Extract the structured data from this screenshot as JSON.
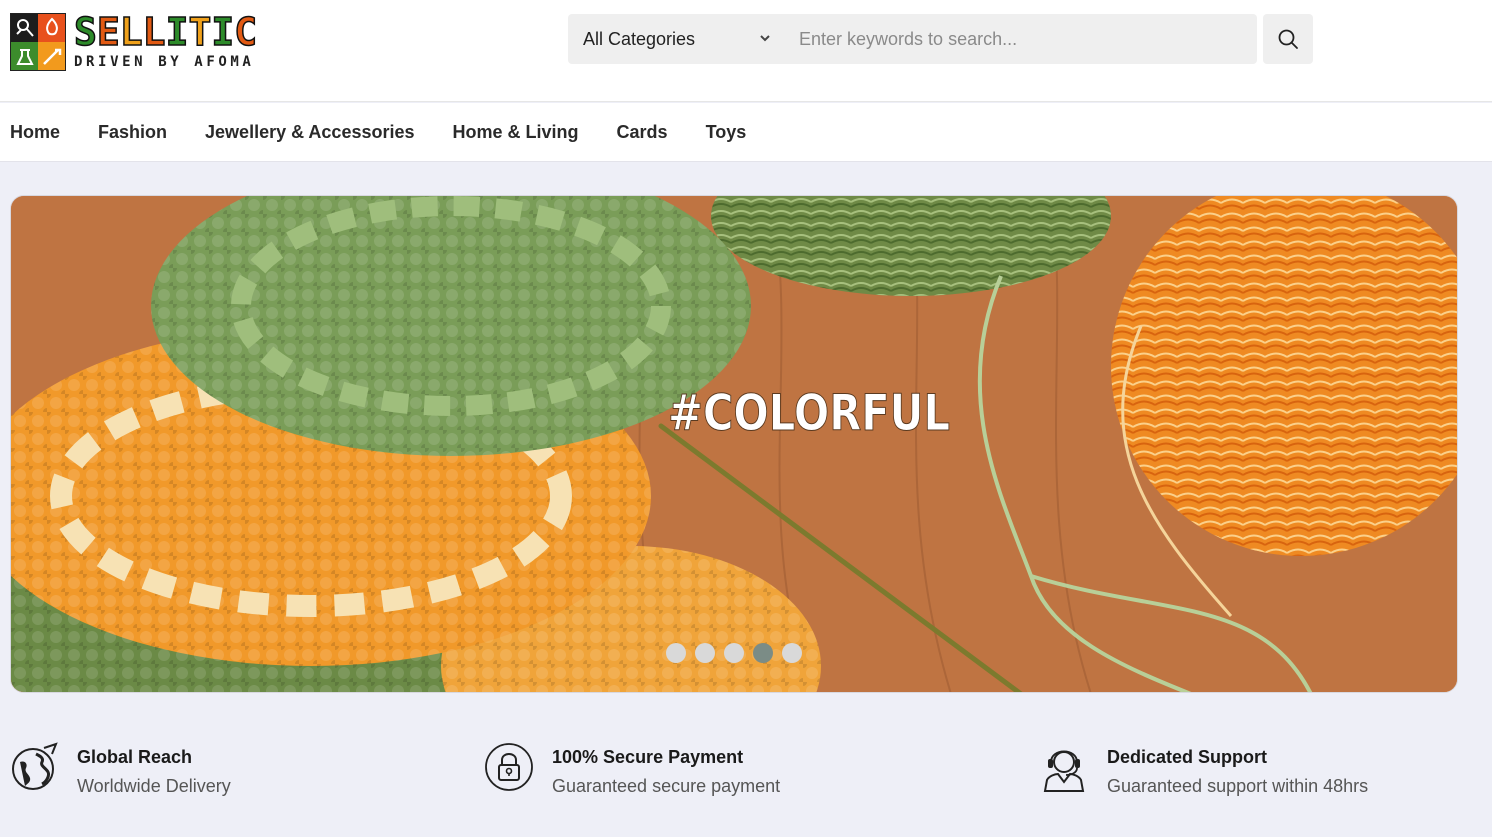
{
  "brand": {
    "name": "SELLITIC",
    "tagline": "DRIVEN BY AFOMA"
  },
  "search": {
    "category_selected": "All Categories",
    "placeholder": "Enter keywords to search...",
    "value": ""
  },
  "nav": {
    "items": [
      "Home",
      "Fashion",
      "Jewellery & Accessories",
      "Home & Living",
      "Cards",
      "Toys"
    ]
  },
  "banner": {
    "hashtag": "#COLORFUL",
    "slide_count": 5,
    "active_slide": 4
  },
  "features": [
    {
      "title": "Global Reach",
      "subtitle": "Worldwide Delivery",
      "icon": "globe-icon"
    },
    {
      "title": "100% Secure Payment",
      "subtitle": "Guaranteed secure payment",
      "icon": "lock-icon"
    },
    {
      "title": "Dedicated Support",
      "subtitle": "Guaranteed support within 48hrs",
      "icon": "headset-icon"
    }
  ],
  "colors": {
    "page_bg": "#eeeff7",
    "brand_green": "#2d8b2a",
    "brand_orange": "#e25a13",
    "active_dot": "#7b8c86"
  }
}
